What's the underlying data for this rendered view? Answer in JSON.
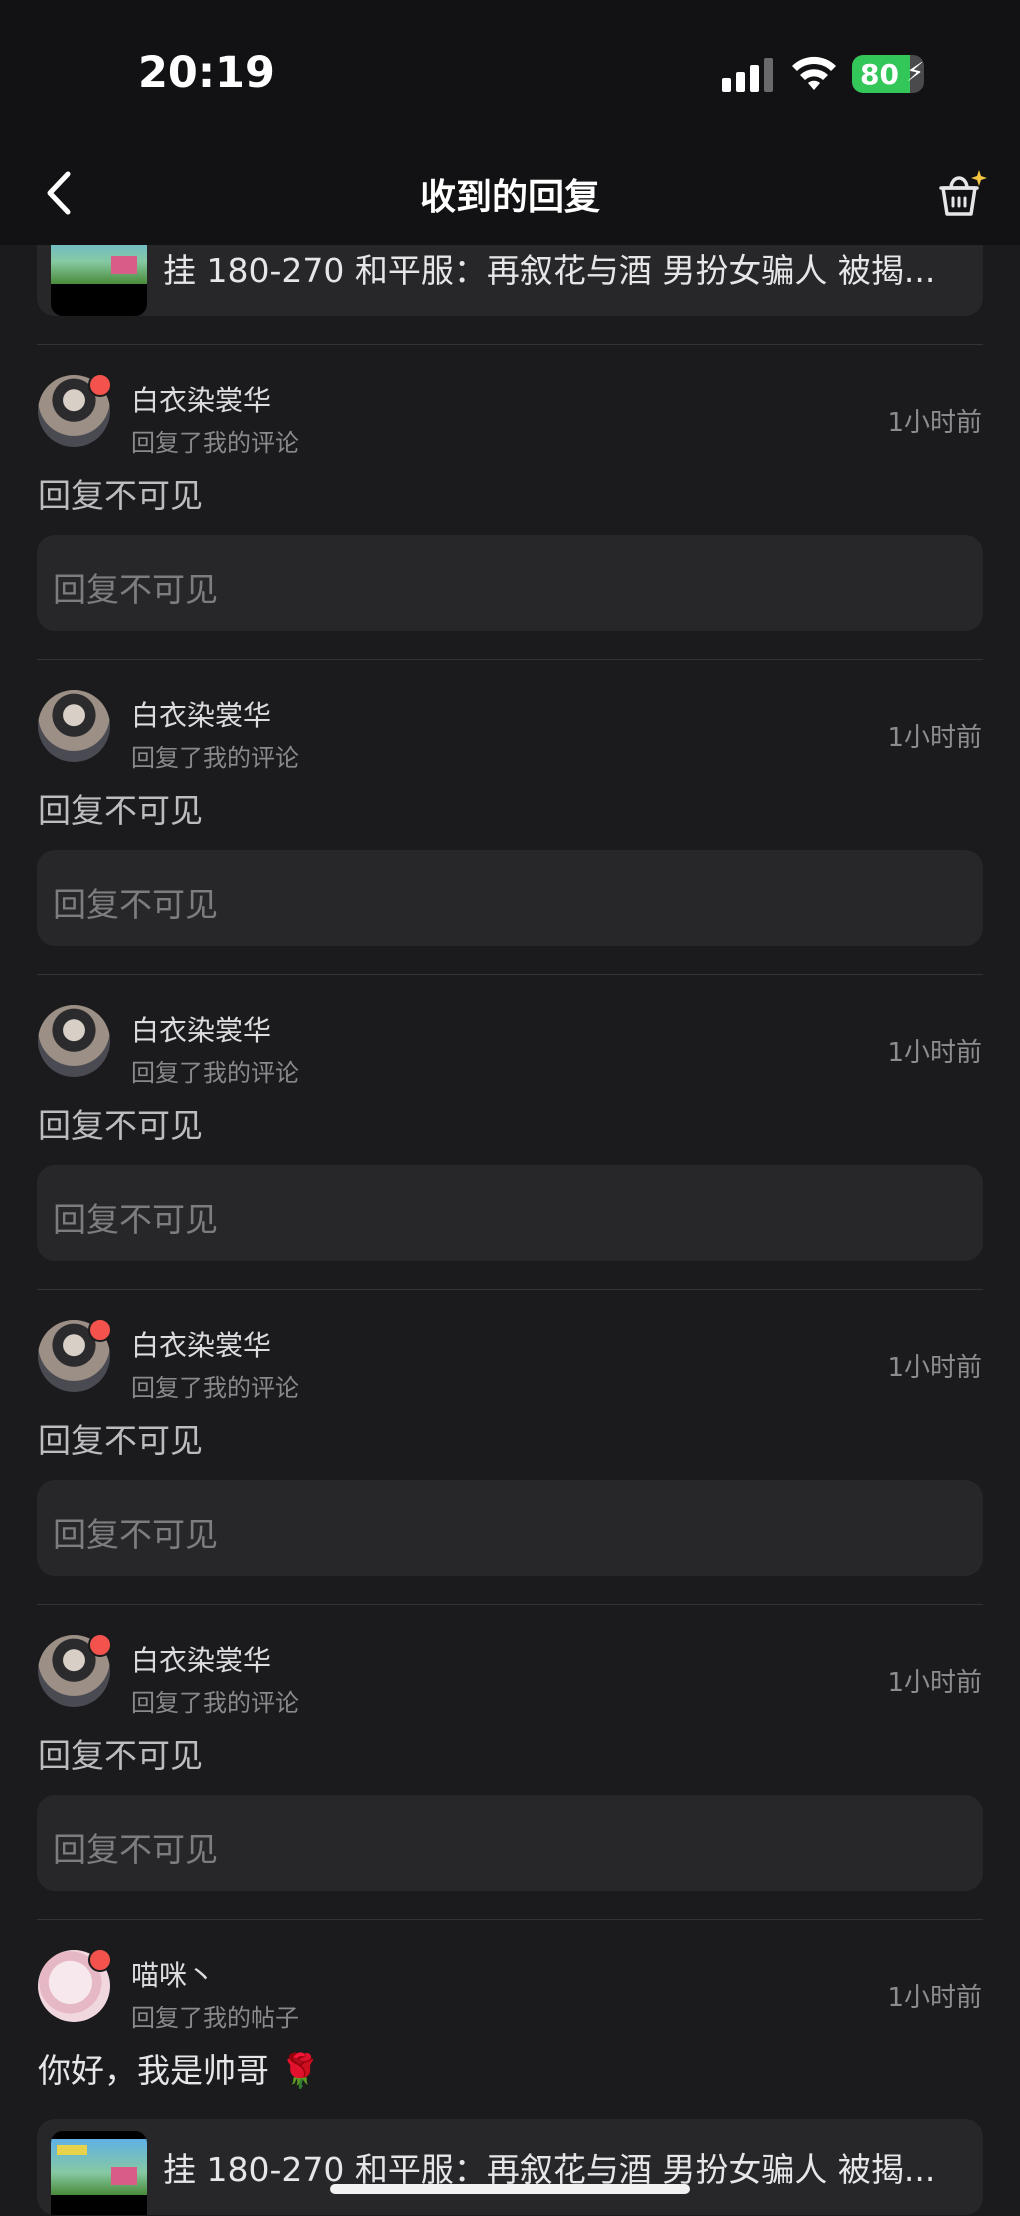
{
  "status": {
    "time": "20:19",
    "battery": "80",
    "battery_level": 0.8
  },
  "nav": {
    "title": "收到的回复"
  },
  "post_link_text": "挂 180-270 和平服：再叙花与酒 男扮女骗人 被揭...",
  "items": [
    {
      "name": "白衣染裳华",
      "action": "回复了我的评论",
      "time": "1小时前",
      "reply": "回复不可见",
      "quote": "回复不可见",
      "unread": true
    },
    {
      "name": "白衣染裳华",
      "action": "回复了我的评论",
      "time": "1小时前",
      "reply": "回复不可见",
      "quote": "回复不可见",
      "unread": false
    },
    {
      "name": "白衣染裳华",
      "action": "回复了我的评论",
      "time": "1小时前",
      "reply": "回复不可见",
      "quote": "回复不可见",
      "unread": false
    },
    {
      "name": "白衣染裳华",
      "action": "回复了我的评论",
      "time": "1小时前",
      "reply": "回复不可见",
      "quote": "回复不可见",
      "unread": true
    },
    {
      "name": "白衣染裳华",
      "action": "回复了我的评论",
      "time": "1小时前",
      "reply": "回复不可见",
      "quote": "回复不可见",
      "unread": true
    }
  ],
  "last_item": {
    "name": "喵咪丶",
    "action": "回复了我的帖子",
    "time": "1小时前",
    "reply": "你好，我是帅哥 🌹",
    "unread": true
  }
}
